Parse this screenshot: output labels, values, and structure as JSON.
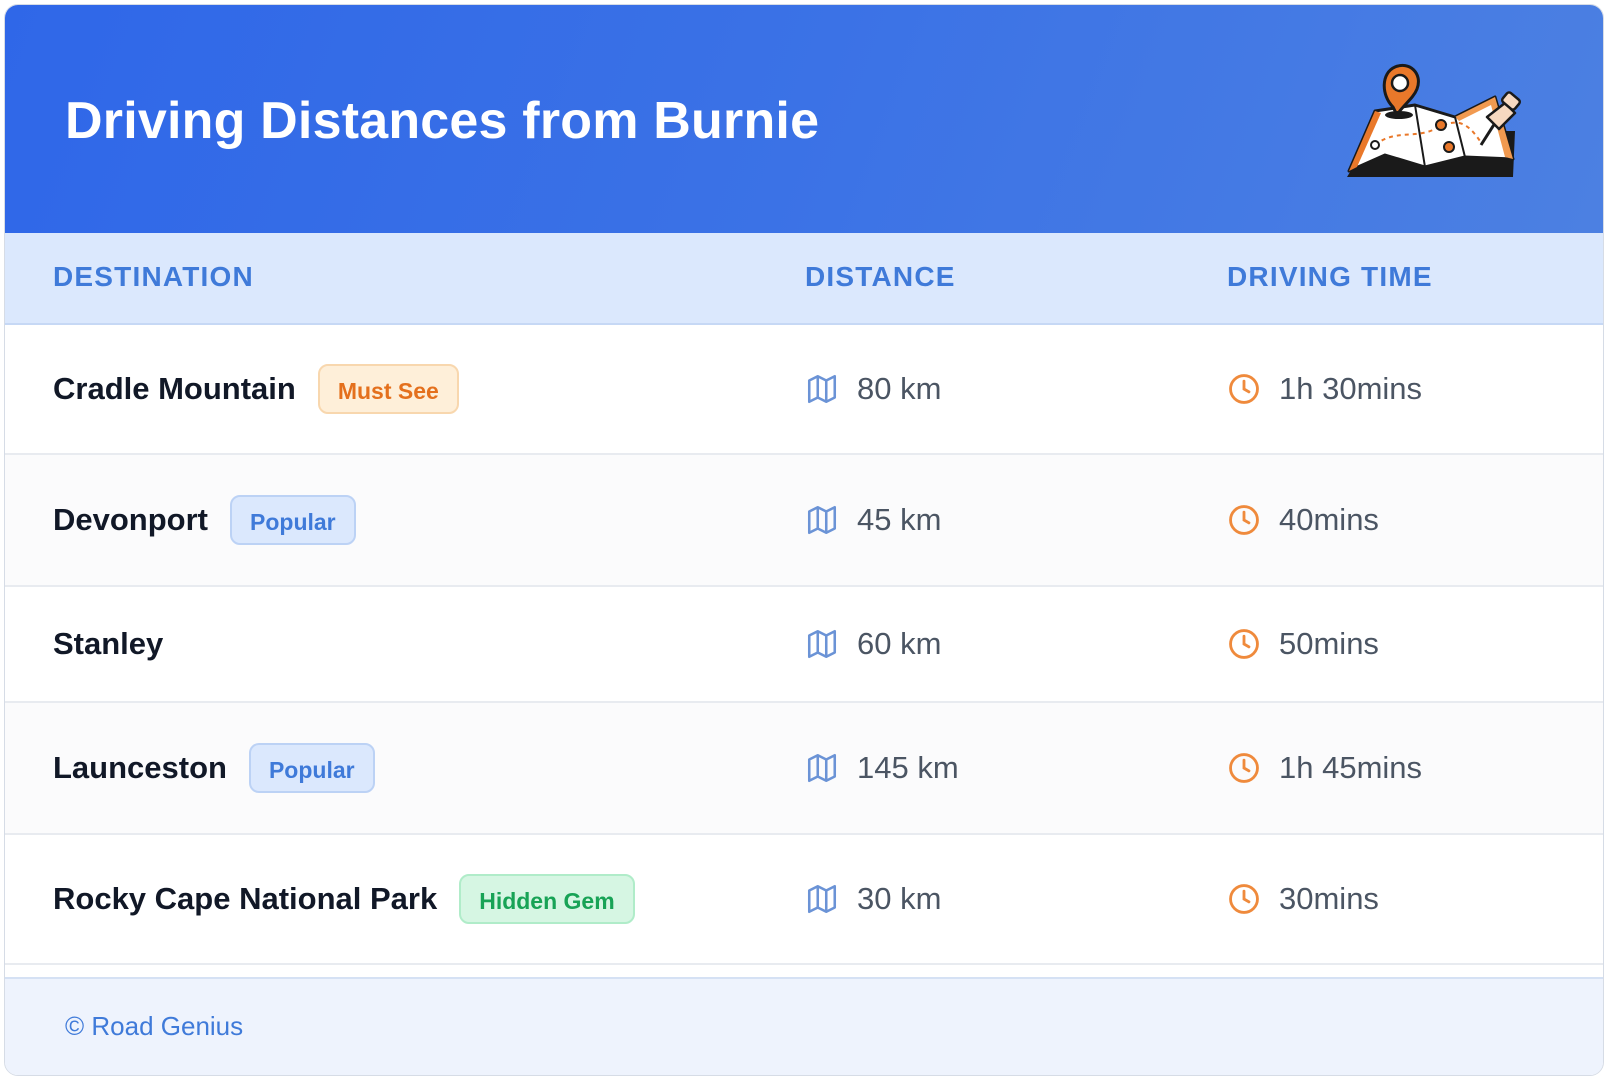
{
  "header": {
    "title": "Driving Distances from Burnie",
    "illustration_icon": "map-with-pins-icon"
  },
  "table": {
    "columns": [
      "DESTINATION",
      "DISTANCE",
      "DRIVING TIME"
    ],
    "rows": [
      {
        "destination": "Cradle Mountain",
        "badge": "Must See",
        "badge_color": "orange",
        "distance": "80 km",
        "time": "1h 30mins"
      },
      {
        "destination": "Devonport",
        "badge": "Popular",
        "badge_color": "blue",
        "distance": "45 km",
        "time": "40mins"
      },
      {
        "destination": "Stanley",
        "badge": "",
        "badge_color": "",
        "distance": "60 km",
        "time": "50mins"
      },
      {
        "destination": "Launceston",
        "badge": "Popular",
        "badge_color": "blue",
        "distance": "145 km",
        "time": "1h 45mins"
      },
      {
        "destination": "Rocky Cape National Park",
        "badge": "Hidden Gem",
        "badge_color": "green",
        "distance": "30 km",
        "time": "30mins"
      }
    ]
  },
  "icons": {
    "distance": "map-icon",
    "time": "clock-icon"
  },
  "colors": {
    "header_gradient_start": "#2f67e8",
    "header_gradient_end": "#4c80e2",
    "accent_blue": "#3f7ad9",
    "accent_orange": "#e4701d",
    "accent_green": "#18a356"
  },
  "footer": {
    "text": "© Road Genius"
  }
}
